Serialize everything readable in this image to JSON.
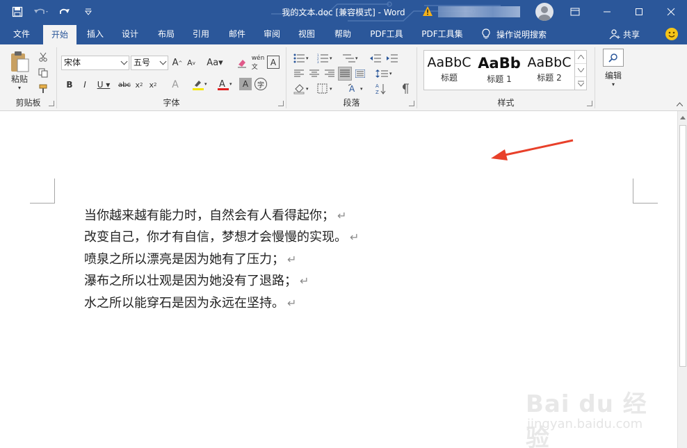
{
  "titlebar": {
    "title": "我的文本.doc [兼容模式]  -  Word",
    "colors": {
      "brand": "#2b579a"
    },
    "icons": [
      "save-icon",
      "undo-icon",
      "redo-icon",
      "customize-qat-icon",
      "warning-icon",
      "user-avatar-icon",
      "ribbon-display-icon",
      "minimize-icon",
      "maximize-icon",
      "close-icon"
    ]
  },
  "tabs": [
    "文件",
    "开始",
    "插入",
    "设计",
    "布局",
    "引用",
    "邮件",
    "审阅",
    "视图",
    "帮助",
    "PDF工具",
    "PDF工具集"
  ],
  "active_tab": "开始",
  "tell_me": "操作说明搜索",
  "share": "共享",
  "ribbon": {
    "clipboard": {
      "paste": "粘贴",
      "label": "剪贴板"
    },
    "font": {
      "name": "宋体",
      "size": "五号",
      "label": "字体"
    },
    "paragraph": {
      "label": "段落"
    },
    "styles": {
      "label": "样式",
      "items": [
        {
          "sample": "AaBbC",
          "name": "标题"
        },
        {
          "sample": "AaBb",
          "name": "标题 1"
        },
        {
          "sample": "AaBbC",
          "name": "标题 2"
        }
      ]
    },
    "editing": {
      "label": "编辑"
    }
  },
  "document": {
    "paragraphs": [
      "当你越来越有能力时，自然会有人看得起你；",
      "改变自己，你才有自信，梦想才会慢慢的实现。",
      "喷泉之所以漂亮是因为她有了压力；",
      "瀑布之所以壮观是因为她没有了退路；",
      "水之所以能穿石是因为永远在坚持。"
    ],
    "paragraph_mark": "↵"
  },
  "annotation": {
    "arrow_color": "#e8402a"
  },
  "watermark": {
    "brand": "Bai du 经验",
    "url": "jingyan.baidu.com"
  }
}
